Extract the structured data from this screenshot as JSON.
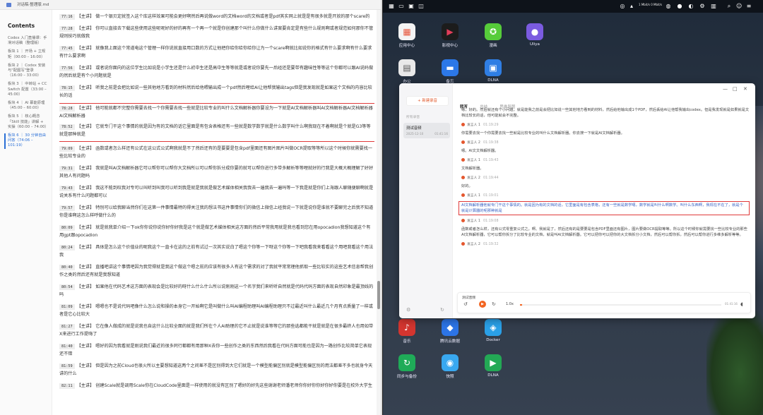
{
  "left_window": {
    "title": "对话稿·整理版.md",
    "toc": {
      "heading": "Contents",
      "items": [
        "Codex 入门直播课：手滑对话稿（整理版）",
        "板块 1 ｜ 开场 + 立规矩（00:00 – 16:00）",
        "板块 2 ｜ Codex 安装与\"配图写\"登录（16:00 – 33:00）",
        "板块 3 ｜ 中转站 + CC Switch 配置（33:00 – 45:00）",
        "板块 4 ｜ AI 幕能原理（45:00 – 60:00）",
        "板块 5 ｜ 核心概念「Skill 技能」讲解 + 实操（60:00 – 74:00）",
        "板块 6 ｜ 30 分钟自由问答（74:06 – 101:19）"
      ]
    },
    "segments": [
      {
        "ts": "77:16",
        "speaker": "【主讲】",
        "text": "做一个银贝定就签入这个库这样效果可能会更好啊然后再说做word的文档word的文档或者是pdf其实网上就是是有很多就是开放的那个scare的"
      },
      {
        "ts": "77:28",
        "speaker": "【主讲】",
        "text": "你可以直接去下载这些使用这些呢呢好的好的再有一个再一个就是你创建那个叫什么你做什么讲案要肯定是有些什么规则啊或者规范如何那你不管规则技巧就做我"
      },
      {
        "ts": "77:45",
        "speaker": "【主讲】",
        "text": "就像我上面这个常道电这个管理一样你说就直接用口数的方式让他把你给你给你给你让为一个scare啊就比如说你的格式有什么要求啊有什么要求有什么要求啊"
      },
      {
        "ts": "77:56",
        "speaker": "【主讲】",
        "text": "或者说你面向的这位学生比如说是小学生还是什么初中生还是高中生等等就是或者说你要先一后经还是要带有趣味性等等这个你都可以跟AI说码做的然后就是有个小问题就是"
      },
      {
        "ts": "78:15",
        "speaker": "【主讲】",
        "text": "听我之前是会把比如说一些其他地方看到的材料然后给他喂输出成一个pdf然后哩给AI让他帮我输出tags但是我发现就是如果这个文档的内容比较长的话"
      },
      {
        "ts": "78:28",
        "speaker": "【主讲】",
        "text": "他可能就都不完整你需要去找一个你需要去找一些就是比较专业的叫什么文档解析器你要设为一下就是AI文档解析器叫AI文档解析器AI文档解析器AI文档解析器"
      },
      {
        "ts": "78:52",
        "speaker": "【主讲】",
        "text": "它就专门干这个事情的就是因为有的文档的话它里面是有包含表格还有一些就是数学数学就是什么数学叫什么啊我现在不着啊就是个就是G3等等就是那种就是"
      },
      {
        "ts": "79:09",
        "speaker": "【主讲】",
        "text": "函数或者怎么样还有公式在这公式公式啊我就是不了然后还有的是要要是包含pdf里面还有图片图片叫做OCR提取等等所以这个时候你就需要找一些比较专业的"
      },
      {
        "ts": "79:31",
        "speaker": "【主讲】",
        "text": "我就是叫AI文档解析器它可以帮你可以帮你大文档所以可以帮你拆分成你要的就可以帮你进行多带多解析等等哩就好的行我是大概大概理解了好好其他人有问题吗"
      },
      {
        "ts": "79:43",
        "speaker": "【主讲】",
        "text": "我这不能到叹我对专可以叫听到叫我可以听到我是就是我就是做艺术媒体相关我我去一遍我去一遍吗等一下我是就是你们上海跟人聊随便聊啊就是说关系有什么问题都可以"
      },
      {
        "ts": "79:57",
        "speaker": "【主讲】",
        "text": "特别可以给我聊当然你们在这第一件事情最特的得关注我的想法书这件事情你们的微信上微信上经我说一下就是说你是谁就不要聊完之后我不知道你是谁啊这怎么样呼做什么的"
      },
      {
        "ts": "80:09",
        "speaker": "【主讲】",
        "text": "就是就我单介绍一下ok你你说你说你好你好我是这个就是做艺术媒体相关这方面的然后平常我用就是我也看到您在用opocadion我想知道这个有用gpt跟opocadion"
      },
      {
        "ts": "80:24",
        "speaker": "【主讲】",
        "text": "具体是怎么这个价值业的呢我这个一直卡在这的之前有试过一次其实说白了嗯这个你等一下呀这个你等一下吧我看我来看看这个用吧我看这个用法我"
      },
      {
        "ts": "80:40",
        "speaker": "【主讲】",
        "text": "直播吧讲这个事情吧因为我觉得就是我这个做这个嗯之前的应该有很多人有这个需求的对了我就平常常理他抓取一些比较实的这些艺术信息帮我创作之类的然后还有就是我想知道"
      },
      {
        "ts": "80:54",
        "speaker": "【主讲】",
        "text": "如果他在代码艺术这方面的表现会是比较好的呀什么什么什么所以说刚刚这一个名字我们来听听自然就是代码代码方面的表现自然印象是最顶线的吗"
      },
      {
        "ts": "81:09",
        "speaker": "【主讲】",
        "text": "嗯嗯也不是说代码吧像什么怎么说和操的本身它一开始啊它是叫做什么叫AI编程助理叫AI编程助理只不过最近叫什么最近几个月有点质量了一样或者是它心比较大"
      },
      {
        "ts": "81:27",
        "speaker": "【主讲】",
        "text": "它在像人做成的就是说我也自这什么比较全面的就是我们所在个人AI助理的它不止就是说谁等等它的那些选都能干就是就是在很多最终人也用如带X来进行工作提嗨了"
      },
      {
        "ts": "81:40",
        "speaker": "【主讲】",
        "text": "嗯好的因为我看就是刚说我们最近的很多同行都都有用那种X去你一些创作之类的东西然后我看在代码方面可能也是因为一路创作比较简单它表现还不错"
      },
      {
        "ts": "81:59",
        "speaker": "【主讲】",
        "text": "但是因为之前Cloud也很火所以主要想知道这两个之间差不是区别得到大它们就是一个模型能偏区别就是模型能偏区别的用法都差不多也就身今天讲的什么"
      },
      {
        "ts": "82:11",
        "speaker": "【主讲】",
        "text": "创建Scale就是调用Scale你在CloudCode里面是一样使用的就没有区别了嗯好的好先这些谢谢老师潘老师你你好你你好你好你要是在校外大学生"
      },
      {
        "ts": "82:30",
        "speaker": "【主讲】",
        "text": "有在实习就是8点那会刚好是我下班在路上的时候所以不太能用电脑我刚问一下今天的会议会有回放吗上来就是我今天会会有要有人要那被我简单被我简来下嗯就是我讲的课堂面"
      }
    ]
  },
  "desktop": {
    "topbar": {
      "left_icons": [
        "grid-icon",
        "dock-icon",
        "terminal-icon",
        "chat-icon"
      ],
      "status": "1 Mbit/s 0 Mbit/s",
      "time_icons": [
        "monitor-icon",
        "bell-icon",
        "settings-icon"
      ]
    },
    "icons": [
      {
        "label": "应用中心",
        "color": "#f4f4f4",
        "glyph": "▦",
        "glyph_color": "#e7563c"
      },
      {
        "label": "影视中心",
        "color": "#1c1c1c",
        "glyph": "▶",
        "glyph_color": "#e23d5a"
      },
      {
        "label": "漫画",
        "color": "#56cc3a",
        "glyph": "✪",
        "glyph_color": "#fff"
      },
      {
        "label": "Uliya",
        "color": "#7b5be0",
        "glyph": "●",
        "glyph_color": "#fff"
      },
      {
        "label": "办公",
        "color": "#e9e9e9",
        "glyph": "▤",
        "glyph_color": "#555"
      },
      {
        "label": "备忘",
        "color": "#2c78e8",
        "glyph": "▬",
        "glyph_color": "#fff"
      },
      {
        "label": "DLNA",
        "color": "#2f7ee4",
        "glyph": "▣",
        "glyph_color": "#fff"
      },
      {
        "label": "音乐",
        "color": "#d3352f",
        "glyph": "♪",
        "glyph_color": "#fff"
      },
      {
        "label": "腾讯云数据",
        "color": "#2c74e6",
        "glyph": "◆",
        "glyph_color": "#fff"
      },
      {
        "label": "Docker",
        "color": "#2aa0e7",
        "glyph": "◈",
        "glyph_color": "#fff"
      },
      {
        "label": "同步与备份",
        "color": "#1fab58",
        "glyph": "↻",
        "glyph_color": "#fff"
      },
      {
        "label": "快照",
        "color": "#39a8f0",
        "glyph": "◉",
        "glyph_color": "#fff"
      },
      {
        "label": "DLNA",
        "color": "#23a955",
        "glyph": "▶",
        "glyph_color": "#fff"
      }
    ]
  },
  "recorder": {
    "new_button": "+ 新建录音",
    "section_label": "所有录音",
    "item": {
      "name": "测试音频",
      "date": "2025-12-10",
      "duration": "01:41:16"
    },
    "tabs": [
      "转写",
      "总结",
      "思维导图"
    ],
    "intro": "嗯，好的。然后就还有个小问题，就是能我之前是会把比如说一些其他地方看到的材料，然后给他输出成1个PDF，然后丢给AI让他帮我输出codex。但是我发现就是如果就是文档比较长的话，他可能就会不完整。",
    "entries": [
      {
        "speaker": "发言人 1",
        "time": "01:19:29",
        "text": "你需要去找一个你需要去找一些就是比较专业的叫什么文档解析器。你去搜一下就是AI文档解析器。"
      },
      {
        "speaker": "发言人 2",
        "time": "01:19:38",
        "text": "嗯。AI文文档解析器。"
      },
      {
        "speaker": "发言人 1",
        "time": "01:19:43",
        "text": "文档解析器。"
      },
      {
        "speaker": "发言人 2",
        "time": "01:19:44",
        "text": "好的。"
      },
      {
        "speaker": "发言人 1",
        "time": "01:19:01",
        "text": "AI文档解析器他就专门干这个事情的。就是因为有的文档的话，它里面是有包含表格，还有一些就是数学嗯，数学就是叫什么啊数学。叫什么东西啊，我现在不在了，就是个就是计算器的呢那种就是"
      },
      {
        "speaker": "发言人 1",
        "time": "01:19:08",
        "text": "函数或者怎么样，还有公式零重复公式之。啊、我就是了，然后还有的是要要是包含PDF里面还有图片，图片要做OCR提取等等。所以这个时候你就需要找一些比较专业的那些AI文档解析器，它可以帮你拆分了比较专业的文档，就是叫AI文档解析器。它可以把你可以把你的大文档拆分小文档，然后可以帮你拆，然后可以帮你进行多维多解析等等。"
      },
      {
        "speaker": "发言人 2",
        "time": "01:19:32",
        "text": ""
      }
    ],
    "player": {
      "name": "测试音频",
      "speed": "1.0x",
      "progress": 0.01,
      "time": "01:41:16"
    }
  }
}
